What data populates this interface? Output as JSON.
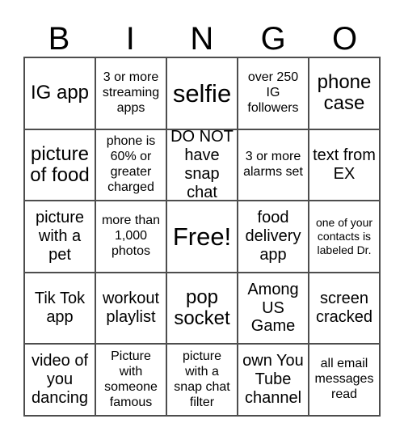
{
  "card": {
    "title_letters": [
      "B",
      "I",
      "N",
      "G",
      "O"
    ],
    "columns": 5,
    "rows": 5,
    "border_color": "#4d4d4d",
    "background_color": "#ffffff",
    "text_color": "#000000",
    "free_space": "Free!",
    "cells": [
      [
        {
          "text": "IG app",
          "size": "lg"
        },
        {
          "text": "3 or more streaming apps",
          "size": "sm"
        },
        {
          "text": "selfie",
          "size": "xl"
        },
        {
          "text": "over 250 IG followers",
          "size": "sm"
        },
        {
          "text": "phone case",
          "size": "lg"
        }
      ],
      [
        {
          "text": "picture of food",
          "size": "lg"
        },
        {
          "text": "phone is 60% or greater charged",
          "size": "sm"
        },
        {
          "text": "DO NOT have snap chat",
          "size": "md"
        },
        {
          "text": "3 or more alarms set",
          "size": "sm"
        },
        {
          "text": "text from EX",
          "size": "md"
        }
      ],
      [
        {
          "text": "picture with a pet",
          "size": "md"
        },
        {
          "text": "more than 1,000 photos",
          "size": "sm"
        },
        {
          "text": "Free!",
          "size": "xl"
        },
        {
          "text": "food delivery app",
          "size": "md"
        },
        {
          "text": "one of your contacts is labeled Dr.",
          "size": "xs"
        }
      ],
      [
        {
          "text": "Tik Tok app",
          "size": "md"
        },
        {
          "text": "workout playlist",
          "size": "md"
        },
        {
          "text": "pop socket",
          "size": "lg"
        },
        {
          "text": "Among US Game",
          "size": "md"
        },
        {
          "text": "screen cracked",
          "size": "md"
        }
      ],
      [
        {
          "text": "video of you dancing",
          "size": "md"
        },
        {
          "text": "Picture with someone famous",
          "size": "sm"
        },
        {
          "text": "picture with a snap chat filter",
          "size": "sm"
        },
        {
          "text": "own You Tube channel",
          "size": "md"
        },
        {
          "text": "all email messages read",
          "size": "sm"
        }
      ]
    ]
  }
}
